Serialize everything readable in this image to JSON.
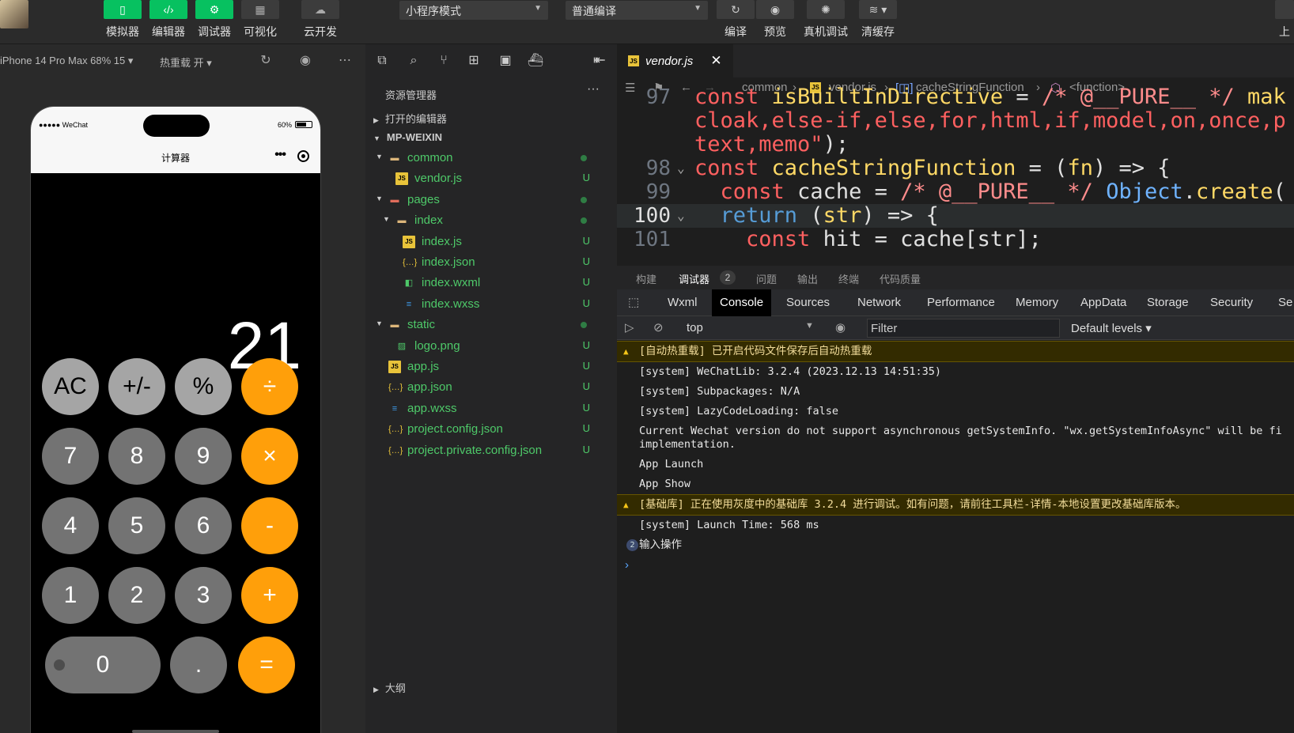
{
  "toolbar": {
    "left_buttons": [
      {
        "label": "模拟器",
        "icon": "phone-icon"
      },
      {
        "label": "编辑器",
        "icon": "code-icon"
      },
      {
        "label": "调试器",
        "icon": "debug-icon"
      },
      {
        "label": "可视化",
        "icon": "layout-icon"
      },
      {
        "label": "云开发",
        "icon": "cloud-icon"
      }
    ],
    "mode_select": "小程序模式",
    "compile_select": "普通编译",
    "right_buttons": [
      {
        "label": "编译",
        "icon": "refresh-icon"
      },
      {
        "label": "预览",
        "icon": "eye-icon"
      },
      {
        "label": "真机调试",
        "icon": "bug-icon"
      },
      {
        "label": "清缓存",
        "icon": "layers-icon"
      }
    ],
    "upload_label": "上"
  },
  "simulator": {
    "device": "iPhone 14 Pro Max 68% 15 ▾",
    "hot_reload": "热重载 开 ▾",
    "status_left": "●●●●● WeChat",
    "status_right": "60%",
    "page_title": "计算器",
    "display": "21",
    "keys": [
      [
        "AC",
        "+/-",
        "%",
        "÷"
      ],
      [
        "7",
        "8",
        "9",
        "×"
      ],
      [
        "4",
        "5",
        "6",
        "-"
      ],
      [
        "1",
        "2",
        "3",
        "+"
      ],
      [
        "0",
        ".",
        "="
      ]
    ]
  },
  "explorer": {
    "title": "资源管理器",
    "open_editors": "打开的编辑器",
    "root": "MP-WEIXIN",
    "outline": "大纲",
    "tree": [
      {
        "label": "common",
        "type": "folder",
        "depth": 1,
        "expanded": true,
        "status": "dot"
      },
      {
        "label": "vendor.js",
        "type": "js",
        "depth": 2,
        "status": "U"
      },
      {
        "label": "pages",
        "type": "folder-red",
        "depth": 1,
        "expanded": true,
        "status": "dot"
      },
      {
        "label": "index",
        "type": "folder",
        "depth": 2,
        "expanded": true,
        "status": "dot"
      },
      {
        "label": "index.js",
        "type": "js",
        "depth": 3,
        "status": "U"
      },
      {
        "label": "index.json",
        "type": "json",
        "depth": 3,
        "status": "U"
      },
      {
        "label": "index.wxml",
        "type": "wxml",
        "depth": 3,
        "status": "U"
      },
      {
        "label": "index.wxss",
        "type": "wxss",
        "depth": 3,
        "status": "U"
      },
      {
        "label": "static",
        "type": "folder",
        "depth": 1,
        "expanded": true,
        "status": "dot"
      },
      {
        "label": "logo.png",
        "type": "png",
        "depth": 2,
        "status": "U"
      },
      {
        "label": "app.js",
        "type": "js",
        "depth": 1,
        "status": "U"
      },
      {
        "label": "app.json",
        "type": "json",
        "depth": 1,
        "status": "U"
      },
      {
        "label": "app.wxss",
        "type": "wxss",
        "depth": 1,
        "status": "U"
      },
      {
        "label": "project.config.json",
        "type": "json",
        "depth": 1,
        "status": "U"
      },
      {
        "label": "project.private.config.json",
        "type": "json",
        "depth": 1,
        "status": "U"
      }
    ]
  },
  "editor": {
    "tab": "vendor.js",
    "breadcrumb": [
      "common",
      "vendor.js",
      "cacheStringFunction",
      "<function>"
    ],
    "code_lines": [
      {
        "ln": "97",
        "html_parts": [
          [
            "kw",
            "const "
          ],
          [
            "id",
            "isBuiltInDirective"
          ],
          [
            "plain",
            " = "
          ],
          [
            "cm",
            "/* @__PURE__ */ "
          ],
          [
            "id",
            "mak"
          ]
        ]
      },
      {
        "ln": "",
        "html_parts": [
          [
            "str",
            "cloak,else-if,else,for,html,if,model,on,once,p"
          ]
        ]
      },
      {
        "ln": "",
        "html_parts": [
          [
            "str",
            "text,memo\""
          ],
          [
            "plain",
            ");"
          ]
        ]
      },
      {
        "ln": "98",
        "fold": true,
        "html_parts": [
          [
            "kw",
            "const "
          ],
          [
            "id",
            "cacheStringFunction"
          ],
          [
            "plain",
            " = ("
          ],
          [
            "id",
            "fn"
          ],
          [
            "plain",
            ") => {"
          ]
        ]
      },
      {
        "ln": "99",
        "html_parts": [
          [
            "plain",
            "  "
          ],
          [
            "kw",
            "const "
          ],
          [
            "plain",
            "cache = "
          ],
          [
            "cm",
            "/* @__PURE__ */ "
          ],
          [
            "fn",
            "Object"
          ],
          [
            "plain",
            "."
          ],
          [
            "id",
            "create"
          ],
          [
            "plain",
            "("
          ]
        ]
      },
      {
        "ln": "100",
        "fold": true,
        "current": true,
        "html_parts": [
          [
            "plain",
            "  "
          ],
          [
            "kw2",
            "return "
          ],
          [
            "plain",
            "("
          ],
          [
            "id",
            "str"
          ],
          [
            "plain",
            ") => {"
          ]
        ]
      },
      {
        "ln": "101",
        "html_parts": [
          [
            "plain",
            "    "
          ],
          [
            "kw",
            "const "
          ],
          [
            "plain",
            "hit = cache[str];"
          ]
        ]
      }
    ]
  },
  "debug": {
    "tabs": [
      "构建",
      "调试器",
      "问题",
      "输出",
      "终端",
      "代码质量"
    ],
    "debugger_badge": "2",
    "devtools_tabs": [
      "Wxml",
      "Console",
      "Sources",
      "Network",
      "Performance",
      "Memory",
      "AppData",
      "Storage",
      "Security",
      "Se"
    ],
    "context": "top",
    "filter_placeholder": "Filter",
    "levels": "Default levels ▾",
    "logs": [
      {
        "type": "warn",
        "text": "[自动热重载] 已开启代码文件保存后自动热重载"
      },
      {
        "type": "info",
        "text": "[system] WeChatLib: 3.2.4 (2023.12.13 14:51:35)"
      },
      {
        "type": "info",
        "text": "[system] Subpackages: N/A"
      },
      {
        "type": "info",
        "text": "[system] LazyCodeLoading: false"
      },
      {
        "type": "info",
        "text": "Current Wechat version do not support asynchronous getSystemInfo. \"wx.getSystemInfoAsync\" will be fi\nimplementation."
      },
      {
        "type": "info",
        "text": "App Launch"
      },
      {
        "type": "info",
        "text": "App Show"
      },
      {
        "type": "warn",
        "text": "[基础库] 正在使用灰度中的基础库 3.2.4 进行调试。如有问题，请前往工具栏-详情-本地设置更改基础库版本。"
      },
      {
        "type": "info",
        "text": "[system] Launch Time: 568 ms"
      },
      {
        "type": "count",
        "count": "2",
        "text": "输入操作"
      }
    ]
  },
  "colors": {
    "accent_green": "#07c160",
    "calc_orange": "#ff9f0a",
    "tree_green": "#4ec969"
  }
}
